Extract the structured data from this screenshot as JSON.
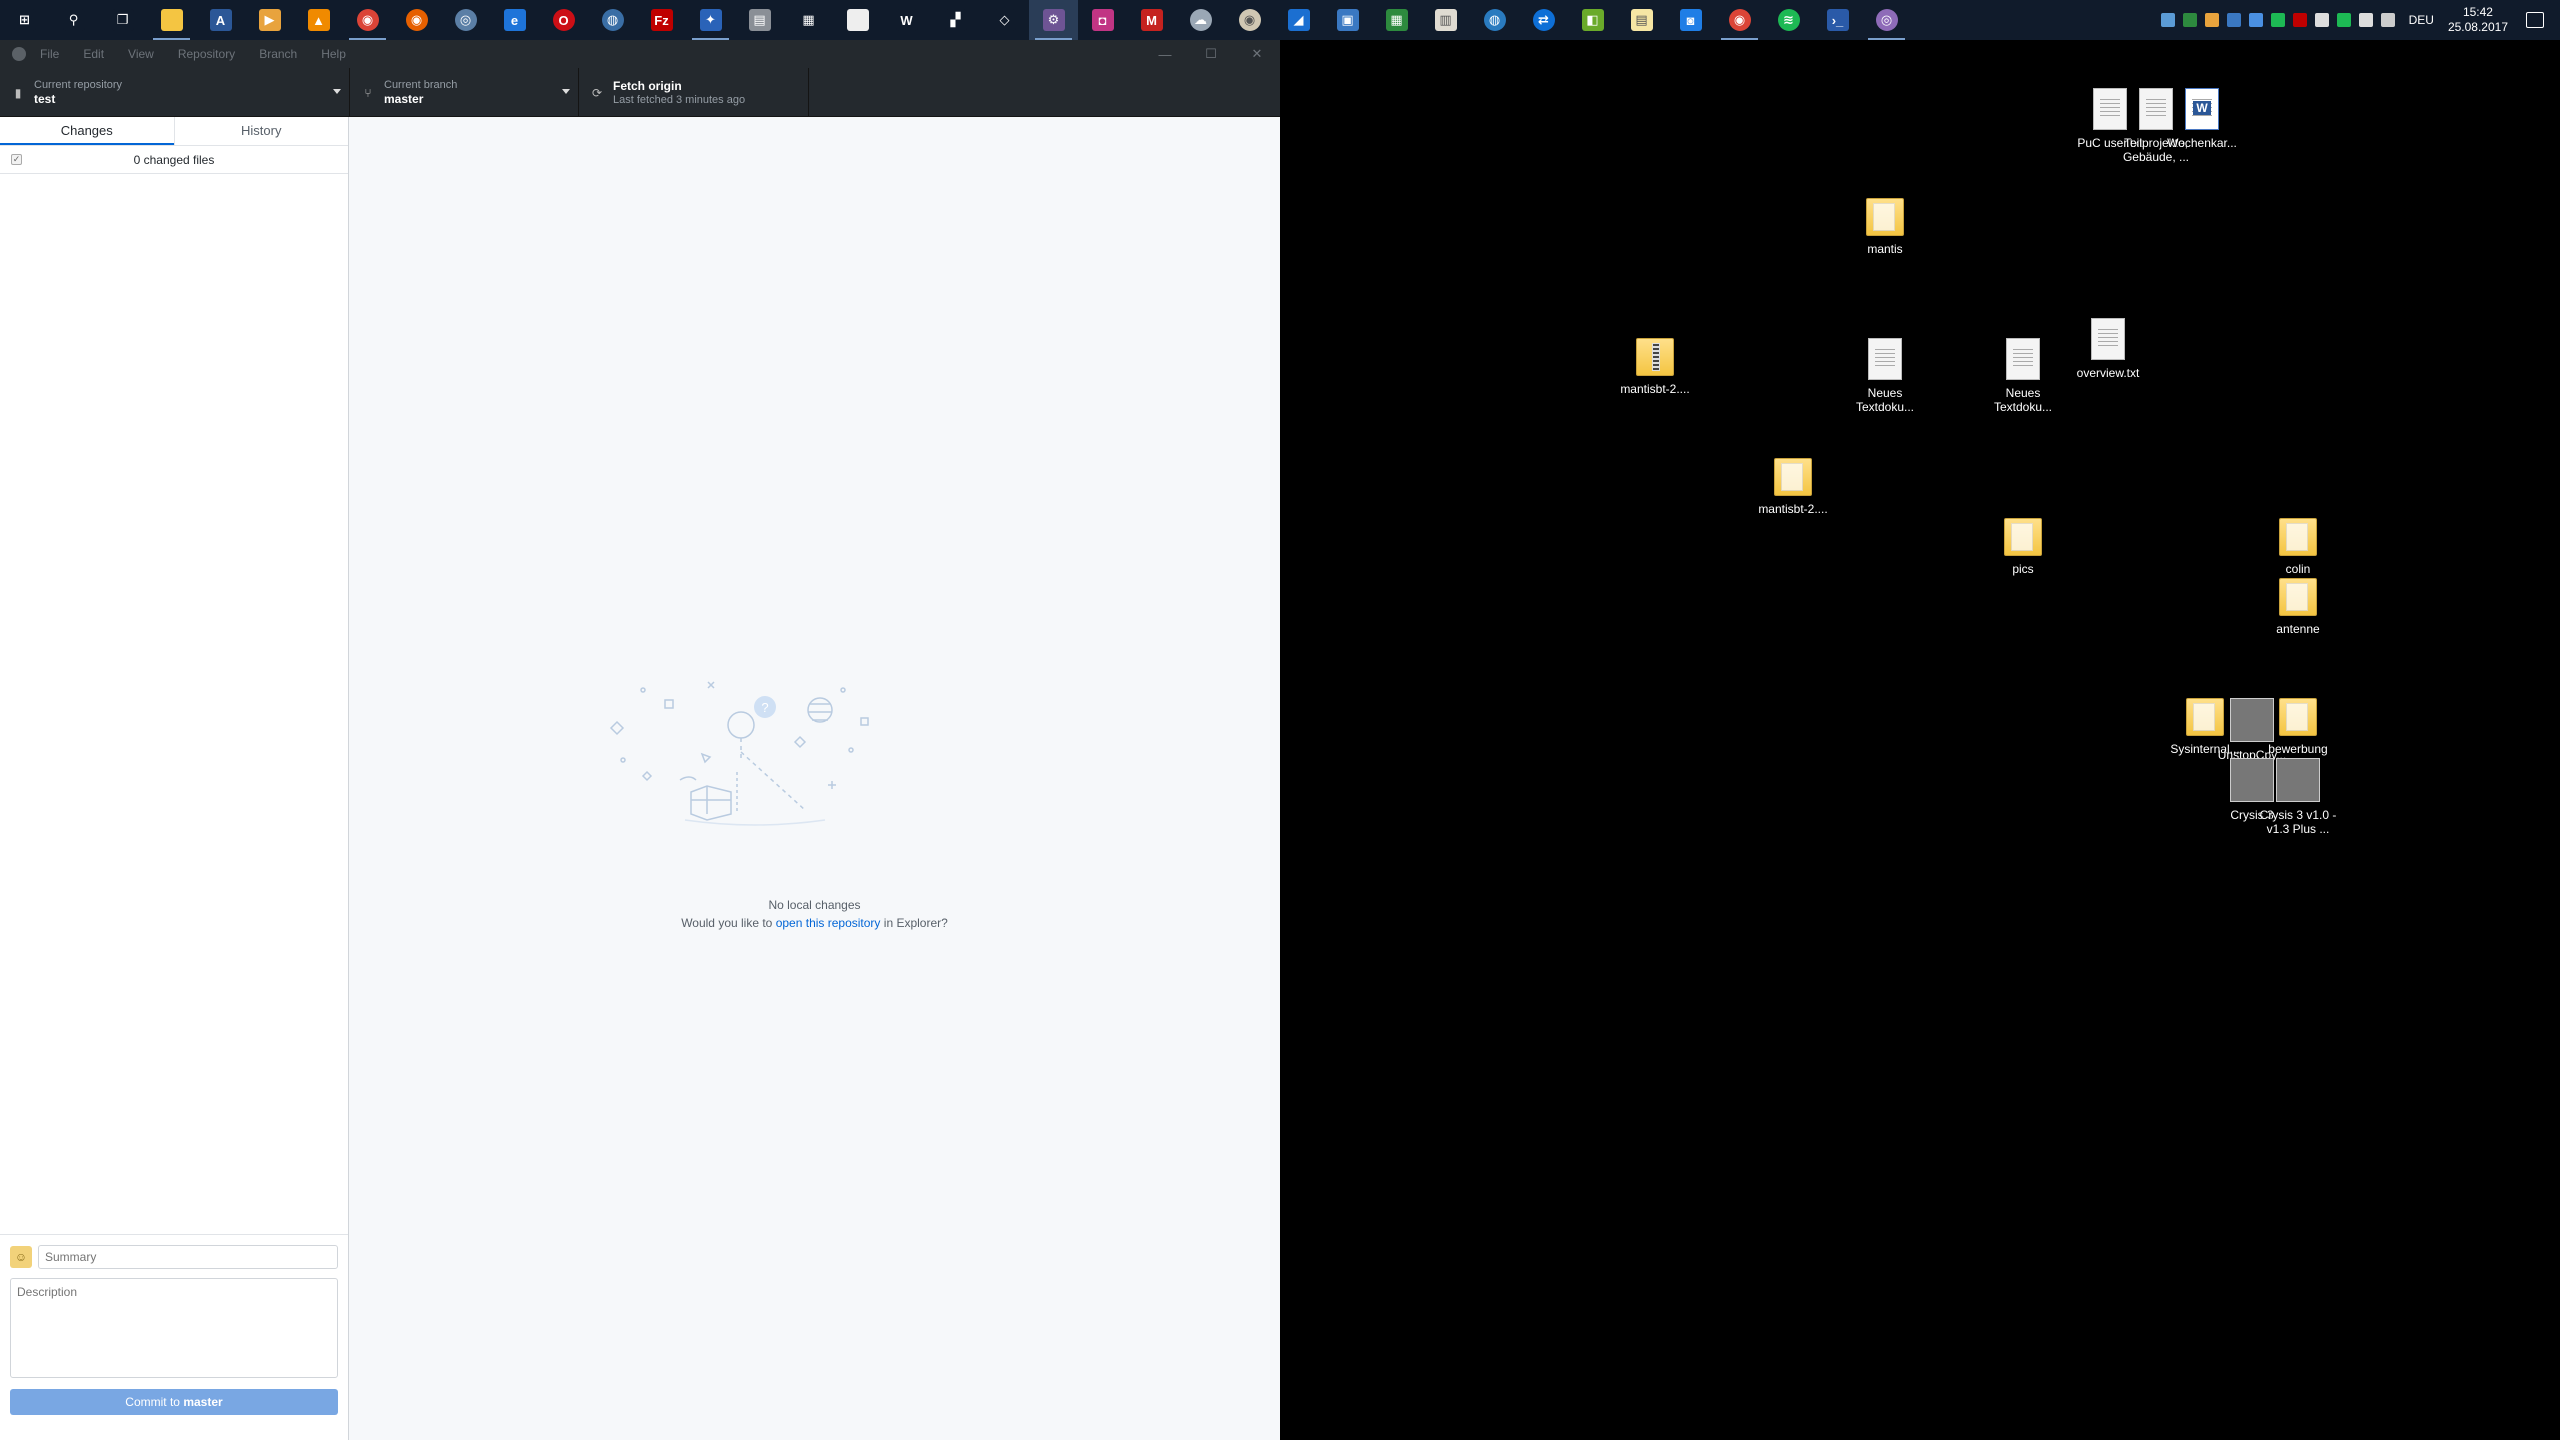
{
  "taskbar": {
    "apps": [
      {
        "name": "start-icon",
        "color": "#101b2b",
        "glyph": "⊞",
        "round": false,
        "running": false
      },
      {
        "name": "search-icon",
        "color": "#101b2b",
        "glyph": "⚲",
        "round": false,
        "running": false
      },
      {
        "name": "task-view-icon",
        "color": "#101b2b",
        "glyph": "❐",
        "round": false,
        "running": false
      },
      {
        "name": "file-explorer-icon",
        "color": "#f4c542",
        "glyph": "",
        "round": false,
        "running": true
      },
      {
        "name": "font-app-icon",
        "color": "#2b5797",
        "glyph": "A",
        "round": false,
        "running": false
      },
      {
        "name": "media-player-icon",
        "color": "#e8a33d",
        "glyph": "▶",
        "round": false,
        "running": false
      },
      {
        "name": "vlc-icon",
        "color": "#f08a00",
        "glyph": "▲",
        "round": false,
        "running": false
      },
      {
        "name": "chrome-icon",
        "color": "#db4437",
        "glyph": "◉",
        "round": true,
        "running": true
      },
      {
        "name": "firefox-icon",
        "color": "#e66000",
        "glyph": "◉",
        "round": true,
        "running": false
      },
      {
        "name": "network-tool-icon",
        "color": "#5b7fa6",
        "glyph": "◎",
        "round": true,
        "running": false
      },
      {
        "name": "edge-icon",
        "color": "#1e74d9",
        "glyph": "e",
        "round": false,
        "running": false
      },
      {
        "name": "opera-icon",
        "color": "#cc0f16",
        "glyph": "O",
        "round": true,
        "running": false
      },
      {
        "name": "vpn-client-icon",
        "color": "#3a6ea5",
        "glyph": "◍",
        "round": true,
        "running": false
      },
      {
        "name": "filezilla-icon",
        "color": "#bf0000",
        "glyph": "Fz",
        "round": false,
        "running": false
      },
      {
        "name": "tool-app-icon",
        "color": "#2a63b8",
        "glyph": "✦",
        "round": false,
        "running": true
      },
      {
        "name": "printer-icon",
        "color": "#8a8f96",
        "glyph": "▤",
        "round": false,
        "running": false
      },
      {
        "name": "calculator-icon",
        "color": "#101b2b",
        "glyph": "▦",
        "round": false,
        "running": false
      },
      {
        "name": "notepad-icon",
        "color": "#eeeeee",
        "glyph": "",
        "round": false,
        "running": false
      },
      {
        "name": "w-app-icon",
        "color": "#101b2b",
        "glyph": "W",
        "round": false,
        "running": false
      },
      {
        "name": "network-map-icon",
        "color": "#101b2b",
        "glyph": "▞",
        "round": false,
        "running": false
      },
      {
        "name": "unity-icon",
        "color": "#101b2b",
        "glyph": "◇",
        "round": false,
        "running": false
      },
      {
        "name": "github-desktop-icon",
        "color": "#6e5494",
        "glyph": "⚙",
        "round": false,
        "running": true
      },
      {
        "name": "instagram-icon",
        "color": "#c13584",
        "glyph": "◘",
        "round": false,
        "running": false
      },
      {
        "name": "gmail-icon",
        "color": "#c5221f",
        "glyph": "M",
        "round": false,
        "running": false
      },
      {
        "name": "cloud-app-icon",
        "color": "#9aa7b5",
        "glyph": "☁",
        "round": true,
        "running": false
      },
      {
        "name": "record-app-icon",
        "color": "#d0c7b3",
        "glyph": "◉",
        "round": true,
        "running": false
      },
      {
        "name": "edit-app-icon",
        "color": "#1b6fd1",
        "glyph": "◢",
        "round": false,
        "running": false
      },
      {
        "name": "control-panel-icon",
        "color": "#3a78c2",
        "glyph": "▣",
        "round": false,
        "running": false
      },
      {
        "name": "tiles-app-icon",
        "color": "#2d8a3e",
        "glyph": "▦",
        "round": false,
        "running": false
      },
      {
        "name": "document-app-icon",
        "color": "#e0dcd2",
        "glyph": "▥",
        "round": false,
        "running": false
      },
      {
        "name": "globe-app-icon",
        "color": "#2a7bbf",
        "glyph": "◍",
        "round": true,
        "running": false
      },
      {
        "name": "teamviewer-icon",
        "color": "#0e6fd6",
        "glyph": "⇄",
        "round": true,
        "running": false
      },
      {
        "name": "green-app-icon",
        "color": "#6aaa2a",
        "glyph": "◧",
        "round": false,
        "running": false
      },
      {
        "name": "notes-app-icon",
        "color": "#f6e6a4",
        "glyph": "▤",
        "round": false,
        "running": false
      },
      {
        "name": "chat-app-icon",
        "color": "#1f7ee6",
        "glyph": "◙",
        "round": false,
        "running": false
      },
      {
        "name": "chrome-profile-icon",
        "color": "#db4437",
        "glyph": "◉",
        "round": true,
        "running": true
      },
      {
        "name": "spotify-icon",
        "color": "#1db954",
        "glyph": "≋",
        "round": true,
        "running": false
      },
      {
        "name": "powershell-icon",
        "color": "#2a5aa8",
        "glyph": "›_",
        "round": false,
        "running": false
      },
      {
        "name": "purple-app-icon",
        "color": "#8e6bb8",
        "glyph": "◎",
        "round": true,
        "running": true
      }
    ],
    "tray_icons": [
      "#5b9bd5",
      "#2d8a3e",
      "#e8a33d",
      "#3a78c2",
      "#4a90e2",
      "#1db954",
      "#bf0000",
      "#dddddd",
      "#1db954",
      "#dddddd",
      "#cccccc"
    ],
    "language": "DEU",
    "time": "15:42",
    "date": "25.08.2017"
  },
  "window": {
    "menu": [
      "File",
      "Edit",
      "View",
      "Repository",
      "Branch",
      "Help"
    ],
    "controls": {
      "minimize": "—",
      "maximize": "☐",
      "close": "✕"
    },
    "toolbar": {
      "repo_label": "Current repository",
      "repo_value": "test",
      "branch_label": "Current branch",
      "branch_value": "master",
      "fetch_title": "Fetch origin",
      "fetch_sub": "Last fetched 3 minutes ago"
    },
    "tabs": {
      "changes": "Changes",
      "history": "History"
    },
    "changed_files": "0 changed files",
    "commit": {
      "summary_placeholder": "Summary",
      "description_placeholder": "Description",
      "button_prefix": "Commit to",
      "button_branch": "master"
    },
    "empty": {
      "title": "No local changes",
      "desc_before": "Would you like to",
      "link": "open this repository",
      "desc_after": "in Explorer?"
    }
  },
  "desktop": {
    "icons": [
      {
        "label": "PuC user.txt",
        "kind": "doc",
        "col": 1,
        "row": 1
      },
      {
        "label": "Teilprojekte, Gebäude, ...",
        "kind": "doc",
        "col": 2,
        "row": 1
      },
      {
        "label": "Wochenkar...",
        "kind": "word",
        "col": 3,
        "row": 1
      },
      {
        "label": "mantis",
        "kind": "folder",
        "col": 4,
        "row": 2
      },
      {
        "label": "overview.txt",
        "kind": "doc",
        "col": 5,
        "row": 3
      },
      {
        "label": "mantisbt-2....",
        "kind": "zip",
        "col": 6,
        "row": 4
      },
      {
        "label": "Neues Textdoku...",
        "kind": "doc",
        "col": 7,
        "row": 4
      },
      {
        "label": "Neues Textdoku...",
        "kind": "doc",
        "col": 8,
        "row": 4
      },
      {
        "label": "mantisbt-2....",
        "kind": "folder",
        "col": 9,
        "row": 5
      },
      {
        "label": "pics",
        "kind": "folder",
        "col": 10,
        "row": 6
      },
      {
        "label": "colin",
        "kind": "folder",
        "col": 11,
        "row": 6
      },
      {
        "label": "antenne",
        "kind": "folder",
        "col": 12,
        "row": 7
      },
      {
        "label": "Sysinternal...",
        "kind": "folder",
        "col": 13,
        "row": 8
      },
      {
        "label": "UnstopCpy...",
        "kind": "photo",
        "col": 14,
        "row": 8
      },
      {
        "label": "bewerbung",
        "kind": "folder",
        "col": 15,
        "row": 8
      },
      {
        "label": "Crysis 3",
        "kind": "photo",
        "col": 16,
        "row": 9
      },
      {
        "label": "Crysis 3 v1.0 - v1.3 Plus ...",
        "kind": "photo",
        "col": 17,
        "row": 9
      }
    ]
  }
}
